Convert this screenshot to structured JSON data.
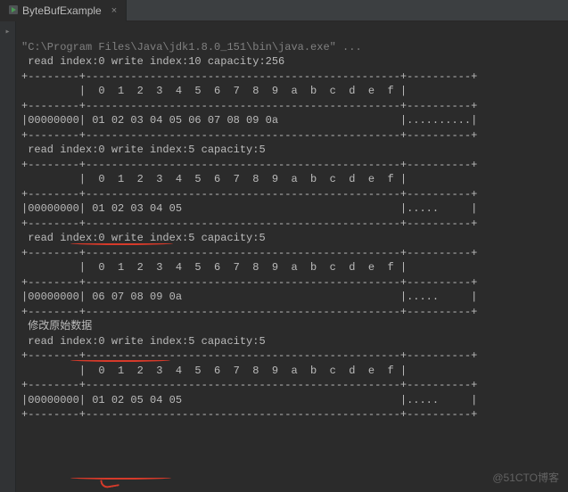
{
  "tab": {
    "title": "ByteBufExample",
    "close": "×"
  },
  "cmd_line": "\"C:\\Program Files\\Java\\jdk1.8.0_151\\bin\\java.exe\" ...",
  "blocks": [
    {
      "header": " read index:0 write index:10 capacity:256",
      "rule_top": "+--------+-------------------------------------------------+----------+",
      "cols": "         |  0  1  2  3  4  5  6  7  8  9  a  b  c  d  e  f |",
      "rule_mid": "+--------+-------------------------------------------------+----------+",
      "data": "|00000000| 01 02 03 04 05 06 07 08 09 0a                   |..........|",
      "rule_bot": "+--------+-------------------------------------------------+----------+"
    },
    {
      "header": " read index:0 write index:5 capacity:5",
      "rule_top": "+--------+-------------------------------------------------+----------+",
      "cols": "         |  0  1  2  3  4  5  6  7  8  9  a  b  c  d  e  f |",
      "rule_mid": "+--------+-------------------------------------------------+----------+",
      "data": "|00000000| 01 02 03 04 05                                  |.....     |",
      "rule_bot": "+--------+-------------------------------------------------+----------+"
    },
    {
      "header": " read index:0 write index:5 capacity:5",
      "rule_top": "+--------+-------------------------------------------------+----------+",
      "cols": "         |  0  1  2  3  4  5  6  7  8  9  a  b  c  d  e  f |",
      "rule_mid": "+--------+-------------------------------------------------+----------+",
      "data": "|00000000| 06 07 08 09 0a                                  |.....     |",
      "rule_bot": "+--------+-------------------------------------------------+----------+"
    }
  ],
  "modify_label": " 修改原始数据",
  "block4": {
    "header": " read index:0 write index:5 capacity:5",
    "rule_top": "+--------+-------------------------------------------------+----------+",
    "cols": "         |  0  1  2  3  4  5  6  7  8  9  a  b  c  d  e  f |",
    "rule_mid": "+--------+-------------------------------------------------+----------+",
    "data": "|00000000| 01 02 05 04 05                                  |.....     |",
    "rule_bot": "+--------+-------------------------------------------------+----------+"
  },
  "watermark": "@51CTO博客"
}
